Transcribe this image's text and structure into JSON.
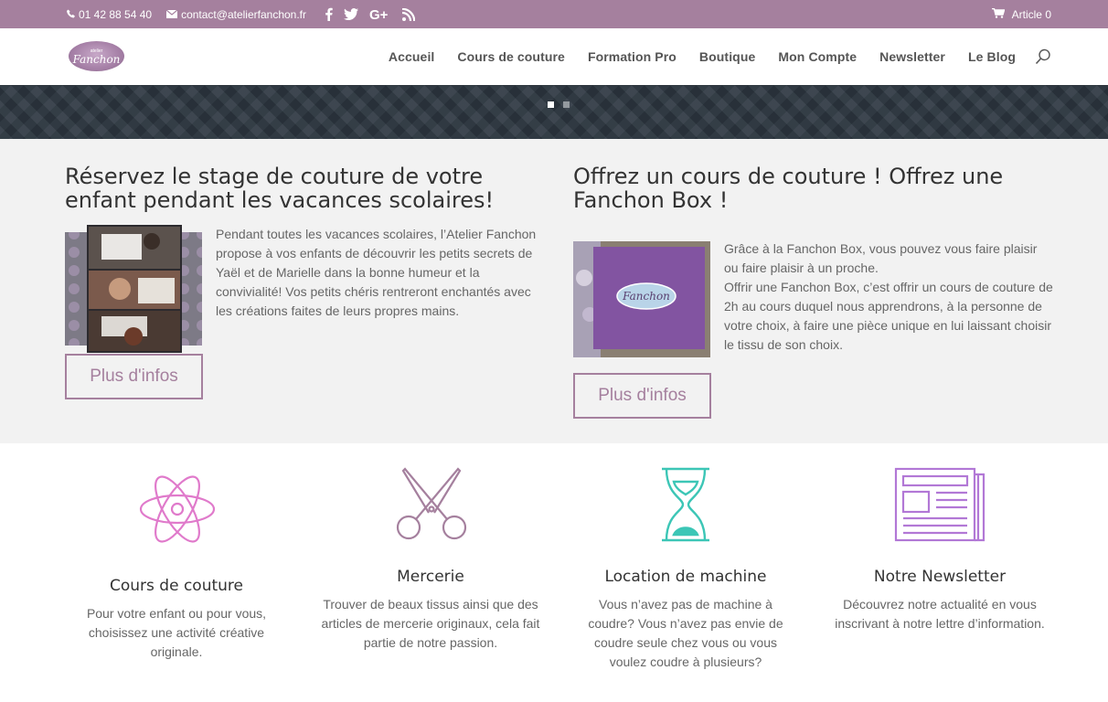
{
  "topbar": {
    "phone": "01 42 88 54 40",
    "email": "contact@atelierfanchon.fr",
    "social_icons": [
      "facebook-icon",
      "twitter-icon",
      "google-plus-icon",
      "rss-icon"
    ],
    "cart_label": "Article 0",
    "bg_color": "#a5809e"
  },
  "header": {
    "logo_small": "atelier",
    "logo_big": "Fanchon",
    "nav": [
      "Accueil",
      "Cours de couture",
      "Formation Pro",
      "Boutique",
      "Mon Compte",
      "Newsletter",
      "Le Blog"
    ]
  },
  "slider": {
    "active_slide": 1,
    "slide_count": 2
  },
  "promo": [
    {
      "title": "Réservez le stage de couture de votre enfant pendant les vacances scolaires!",
      "text": "Pendant toutes les vacances scolaires, l’Atelier Fanchon propose à vos enfants de découvrir les petits secrets de Yaël et de Marielle dans la bonne humeur et la convivialité! Vos petits chéris rentreront enchantés avec les créations faites de leurs propres mains.",
      "button": "Plus d'infos"
    },
    {
      "title": "Offrez un cours de couture ! Offrez une Fanchon Box !",
      "text": "Grâce à la Fanchon Box, vous pouvez vous faire plaisir ou faire plaisir à un proche.\nOffrir une Fanchon Box, c’est offrir un cours de couture de 2h au cours duquel nous apprendrons, à la personne de votre choix, à faire une pièce unique en lui laissant choisir le tissu de son choix.",
      "box_label": "Fanchon",
      "button": "Plus d'infos"
    }
  ],
  "features": [
    {
      "icon": "atom-icon",
      "color": "#e07acb",
      "title": "Cours de couture",
      "text": "Pour votre enfant ou pour vous, choisissez une activité créative originale."
    },
    {
      "icon": "scissors-icon",
      "color": "#a5809e",
      "title": "Mercerie",
      "text": "Trouver de beaux tissus ainsi que des articles de mercerie originaux, cela fait partie de notre passion."
    },
    {
      "icon": "hourglass-icon",
      "color": "#3cc6b6",
      "title": "Location de machine",
      "text": "Vous n’avez pas de machine à coudre? Vous n’avez pas envie de coudre seule chez vous ou vous voulez coudre à plusieurs?"
    },
    {
      "icon": "newspaper-icon",
      "color": "#b278d6",
      "title": "Notre Newsletter",
      "text": "Découvrez notre actualité en vous inscrivant à notre lettre d’information."
    }
  ]
}
